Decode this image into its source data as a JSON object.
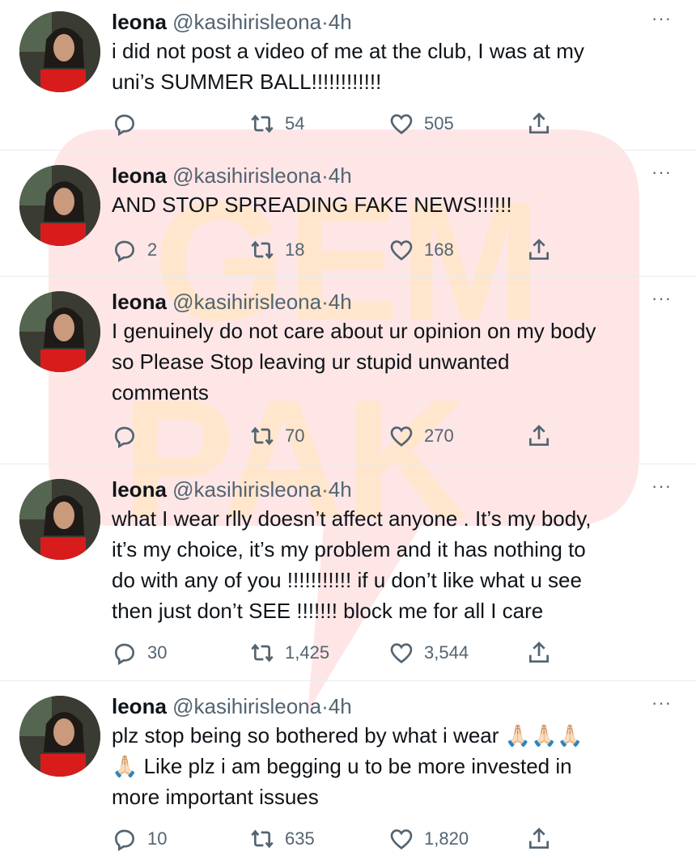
{
  "watermark": {
    "text_line1": "GEM",
    "text_line2": "PAK",
    "color": "#ff2a2a"
  },
  "tweets": [
    {
      "name": "leona",
      "handle": "@kasihirisleona",
      "sep": "·",
      "time": "4h",
      "more": "···",
      "lines": [
        "i did not post a video of me at the club, I was at my",
        "uni’s SUMMER BALL!!!!!!!!!!!!"
      ],
      "replies": "",
      "retweets": "54",
      "likes": "505"
    },
    {
      "name": "leona",
      "handle": "@kasihirisleona",
      "sep": "·",
      "time": "4h",
      "more": "···",
      "lines": [
        "AND STOP SPREADING FAKE NEWS!!!!!!"
      ],
      "replies": "2",
      "retweets": "18",
      "likes": "168"
    },
    {
      "name": "leona",
      "handle": "@kasihirisleona",
      "sep": "·",
      "time": "4h",
      "more": "···",
      "lines": [
        "I genuinely do not care about ur opinion on my body",
        "so Please Stop leaving ur stupid unwanted",
        "comments"
      ],
      "replies": "",
      "retweets": "70",
      "likes": "270"
    },
    {
      "name": "leona",
      "handle": "@kasihirisleona",
      "sep": "·",
      "time": "4h",
      "more": "···",
      "lines": [
        "what I wear rlly doesn’t affect anyone . It’s my body,",
        "it’s my choice, it’s my problem and it has nothing to",
        "do with any of you !!!!!!!!!!! if u don’t like what u see",
        "then just don’t SEE !!!!!!! block me for all I care"
      ],
      "replies": "30",
      "retweets": "1,425",
      "likes": "3,544"
    },
    {
      "name": "leona",
      "handle": "@kasihirisleona",
      "sep": "·",
      "time": "4h",
      "more": "···",
      "lines": [
        "plz stop being so bothered by what i wear 🙏🏻🙏🏻🙏🏻",
        "🙏🏻 Like plz i am begging u to be more invested in",
        "more important issues"
      ],
      "replies": "10",
      "retweets": "635",
      "likes": "1,820"
    }
  ]
}
